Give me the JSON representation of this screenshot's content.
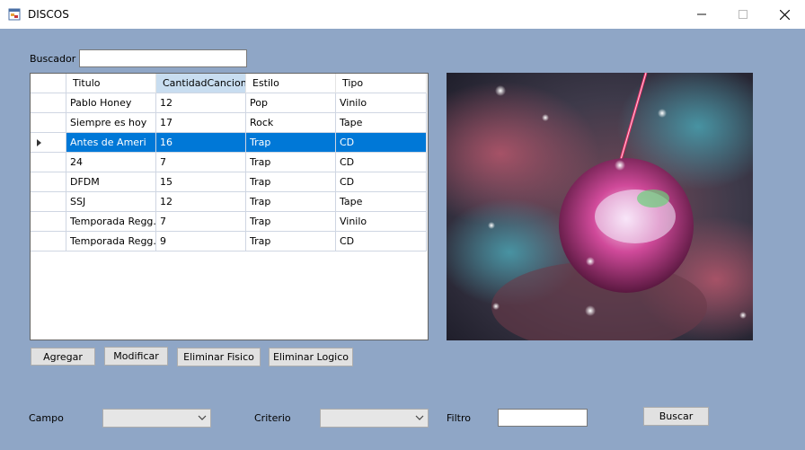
{
  "window": {
    "title": "DISCOS",
    "icon": "app-form-icon"
  },
  "search": {
    "label": "Buscador",
    "value": ""
  },
  "grid": {
    "columns": [
      "Titulo",
      "CantidadCanciones",
      "Estilo",
      "Tipo"
    ],
    "selected_column": 1,
    "selected_row": 2,
    "rows": [
      [
        "Pablo Honey",
        "12",
        "Pop",
        "Vinilo"
      ],
      [
        "Siempre es hoy",
        "17",
        "Rock",
        "Tape"
      ],
      [
        "Antes de Ameri",
        "16",
        "Trap",
        "CD"
      ],
      [
        "24",
        "7",
        "Trap",
        "CD"
      ],
      [
        "DFDM",
        "15",
        "Trap",
        "CD"
      ],
      [
        "SSJ",
        "12",
        "Trap",
        "Tape"
      ],
      [
        "Temporada Regg...",
        "7",
        "Trap",
        "Vinilo"
      ],
      [
        "Temporada Regg...",
        "9",
        "Trap",
        "CD"
      ]
    ]
  },
  "buttons": {
    "add": "Agregar",
    "modify": "Modificar",
    "delete_physical": "Eliminar Fisico",
    "delete_logical": "Eliminar Logico",
    "search": "Buscar"
  },
  "filter": {
    "field_label": "Campo",
    "field_value": "",
    "criteria_label": "Criterio",
    "criteria_value": "",
    "filter_label": "Filtro",
    "filter_value": ""
  },
  "colors": {
    "form_bg": "#8fa6c6",
    "selection": "#0078d7",
    "header_selected": "#c8ddf0"
  }
}
